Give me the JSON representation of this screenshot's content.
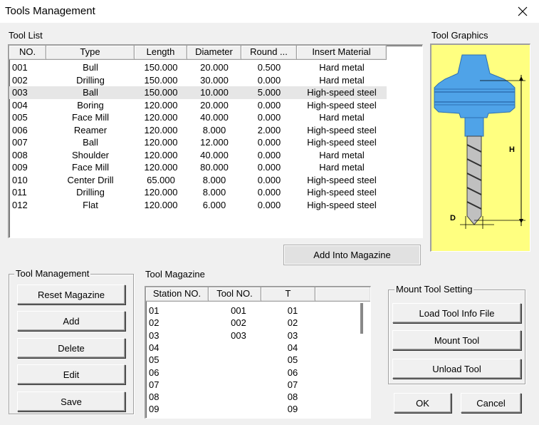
{
  "window": {
    "title": "Tools Management"
  },
  "tool_list": {
    "label": "Tool List",
    "columns": [
      "NO.",
      "Type",
      "Length",
      "Diameter",
      "Round ...",
      "Insert Material"
    ],
    "selected_index": 2,
    "rows": [
      {
        "no": "001",
        "type": "Bull",
        "length": "150.000",
        "diameter": "20.000",
        "round": "0.500",
        "material": "Hard metal"
      },
      {
        "no": "002",
        "type": "Drilling",
        "length": "150.000",
        "diameter": "30.000",
        "round": "0.000",
        "material": "Hard metal"
      },
      {
        "no": "003",
        "type": "Ball",
        "length": "150.000",
        "diameter": "10.000",
        "round": "5.000",
        "material": "High-speed steel"
      },
      {
        "no": "004",
        "type": "Boring",
        "length": "120.000",
        "diameter": "20.000",
        "round": "0.000",
        "material": "High-speed steel"
      },
      {
        "no": "005",
        "type": "Face Mill",
        "length": "120.000",
        "diameter": "40.000",
        "round": "0.000",
        "material": "Hard metal"
      },
      {
        "no": "006",
        "type": "Reamer",
        "length": "120.000",
        "diameter": "8.000",
        "round": "2.000",
        "material": "High-speed steel"
      },
      {
        "no": "007",
        "type": "Ball",
        "length": "120.000",
        "diameter": "12.000",
        "round": "0.000",
        "material": "High-speed steel"
      },
      {
        "no": "008",
        "type": "Shoulder",
        "length": "120.000",
        "diameter": "40.000",
        "round": "0.000",
        "material": "Hard metal"
      },
      {
        "no": "009",
        "type": "Face Mill",
        "length": "120.000",
        "diameter": "80.000",
        "round": "0.000",
        "material": "Hard metal"
      },
      {
        "no": "010",
        "type": "Center Drill",
        "length": "65.000",
        "diameter": "8.000",
        "round": "0.000",
        "material": "High-speed steel"
      },
      {
        "no": "011",
        "type": "Drilling",
        "length": "120.000",
        "diameter": "8.000",
        "round": "0.000",
        "material": "High-speed steel"
      },
      {
        "no": "012",
        "type": "Flat",
        "length": "120.000",
        "diameter": "6.000",
        "round": "0.000",
        "material": "High-speed steel"
      }
    ]
  },
  "tool_graphics": {
    "label": "Tool Graphics",
    "dim_h": "H",
    "dim_d": "D",
    "body_color": "#4fa3e8",
    "background_color": "#ffff80"
  },
  "add_into_magazine_label": "Add Into Magazine",
  "tool_management": {
    "label": "Tool Management",
    "buttons": [
      "Reset Magazine",
      "Add",
      "Delete",
      "Edit",
      "Save"
    ]
  },
  "tool_magazine": {
    "label": "Tool Magazine",
    "columns": [
      "Station NO.",
      "Tool NO.",
      "T"
    ],
    "rows": [
      {
        "station": "01",
        "tool": "001",
        "t": "01"
      },
      {
        "station": "02",
        "tool": "002",
        "t": "02"
      },
      {
        "station": "03",
        "tool": "003",
        "t": "03"
      },
      {
        "station": "04",
        "tool": "",
        "t": "04"
      },
      {
        "station": "05",
        "tool": "",
        "t": "05"
      },
      {
        "station": "06",
        "tool": "",
        "t": "06"
      },
      {
        "station": "07",
        "tool": "",
        "t": "07"
      },
      {
        "station": "08",
        "tool": "",
        "t": "08"
      },
      {
        "station": "09",
        "tool": "",
        "t": "09"
      }
    ]
  },
  "mount_tool_setting": {
    "label": "Mount Tool Setting",
    "buttons": [
      "Load Tool Info File",
      "Mount Tool",
      "Unload Tool"
    ]
  },
  "dialog_buttons": {
    "ok": "OK",
    "cancel": "Cancel"
  }
}
